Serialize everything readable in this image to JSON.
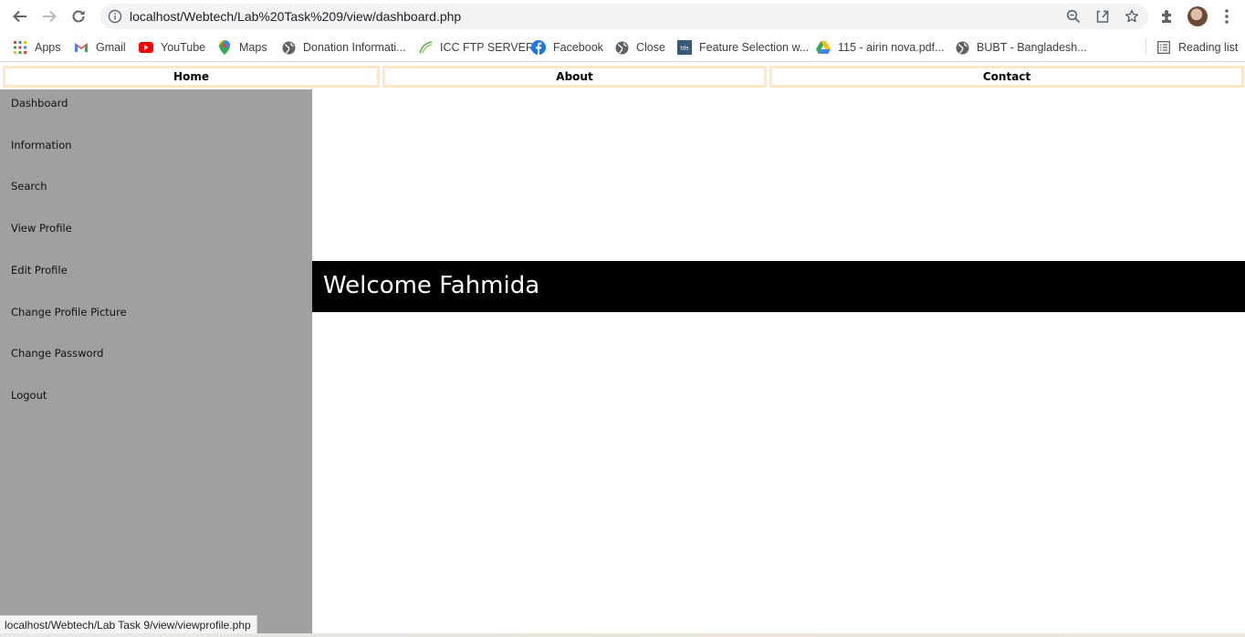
{
  "browser": {
    "url": "localhost/Webtech/Lab%20Task%209/view/dashboard.php",
    "icons": [
      "back-icon",
      "forward-icon",
      "reload-icon",
      "site-info-icon",
      "zoom-icon",
      "share-icon",
      "bookmark-star-icon",
      "extensions-icon",
      "profile-avatar",
      "menu-icon"
    ],
    "bookmarks": [
      {
        "label": "Apps",
        "icon": "apps-grid-icon"
      },
      {
        "label": "Gmail",
        "icon": "gmail-icon"
      },
      {
        "label": "YouTube",
        "icon": "youtube-icon"
      },
      {
        "label": "Maps",
        "icon": "maps-icon"
      },
      {
        "label": "Donation Informati...",
        "icon": "globe-icon"
      },
      {
        "label": "ICC FTP SERVER",
        "icon": "icc-icon"
      },
      {
        "label": "Facebook",
        "icon": "facebook-icon"
      },
      {
        "label": "Close",
        "icon": "globe-icon"
      },
      {
        "label": "Feature Selection w...",
        "icon": "tds-icon"
      },
      {
        "label": "115 - airin nova.pdf...",
        "icon": "google-drive-icon"
      },
      {
        "label": "BUBT - Bangladesh...",
        "icon": "globe-icon"
      }
    ],
    "reading_list": "Reading list",
    "status_url": "localhost/Webtech/Lab Task 9/view/viewprofile.php"
  },
  "topnav": {
    "tabs": [
      "Home",
      "About",
      "Contact"
    ],
    "border_color": "#ffe9c4"
  },
  "sidebar": {
    "items": [
      "Dashboard",
      "Information",
      "Search",
      "View Profile",
      "Edit Profile",
      "Change Profile Picture",
      "Change Password",
      "Logout"
    ],
    "background": "#a0a0a0"
  },
  "main": {
    "welcome": "Welcome Fahmida",
    "welcome_bg": "#000000"
  }
}
